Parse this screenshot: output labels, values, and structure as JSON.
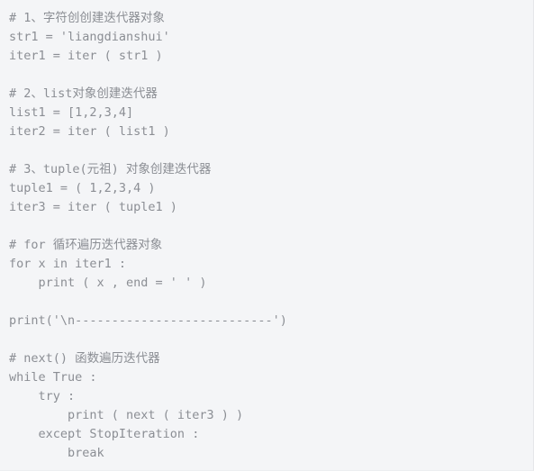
{
  "editor": {
    "background_color": "#f4f5f7",
    "text_color": "#8b8e94",
    "language": "python",
    "lines": [
      "# 1、字符创创建迭代器对象",
      "str1 = 'liangdianshui'",
      "iter1 = iter ( str1 )",
      "",
      "# 2、list对象创建迭代器",
      "list1 = [1,2,3,4]",
      "iter2 = iter ( list1 )",
      "",
      "# 3、tuple(元祖) 对象创建迭代器",
      "tuple1 = ( 1,2,3,4 )",
      "iter3 = iter ( tuple1 )",
      "",
      "# for 循环遍历迭代器对象",
      "for x in iter1 :",
      "    print ( x , end = ' ' )",
      "",
      "print('\\n---------------------------')",
      "",
      "# next() 函数遍历迭代器",
      "while True :",
      "    try :",
      "        print ( next ( iter3 ) )",
      "    except StopIteration :",
      "        break"
    ]
  }
}
